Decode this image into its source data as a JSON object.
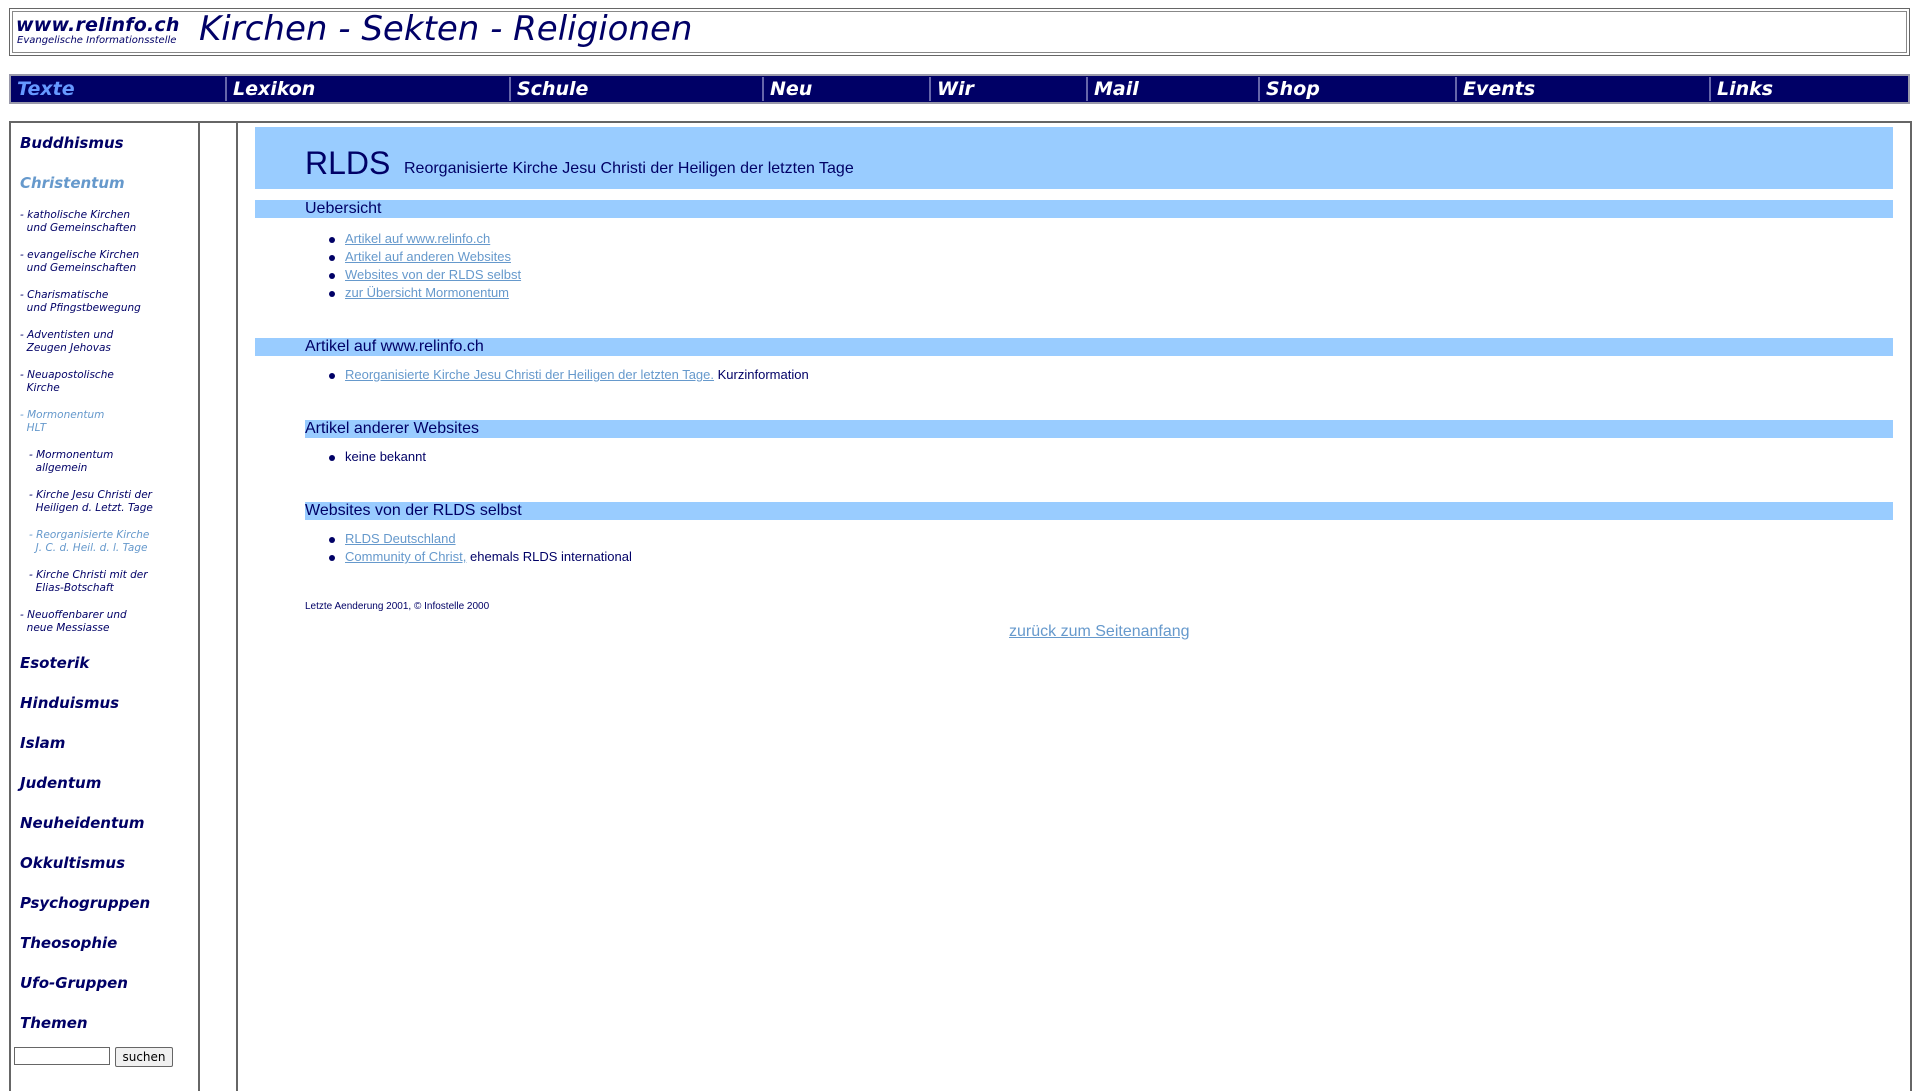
{
  "header": {
    "site_name": "www.relinfo.ch",
    "site_subtitle": "Evangelische Informationsstelle",
    "title": "Kirchen - Sekten - Religionen"
  },
  "nav": {
    "items": [
      "Texte",
      "Lexikon",
      "Schule",
      "Neu",
      "Wir",
      "Mail",
      "Shop",
      "Events",
      "Links"
    ],
    "active": "Texte"
  },
  "sidebar": {
    "top_items": [
      "Buddhismus",
      "Christentum"
    ],
    "sub_items": [
      "- katholische Kirchen\n  und Gemeinschaften",
      "- evangelische Kirchen\n  und Gemeinschaften",
      "- Charismatische\n  und Pfingstbewegung",
      "- Adventisten und\n  Zeugen Jehovas",
      "- Neuapostolische\n  Kirche",
      "- Mormonentum\n  HLT",
      "- Mormonentum\n  allgemein",
      "- Kirche Jesu Christi der\n  Heiligen d. Letzt. Tage",
      "- Reorganisierte Kirche\n  J. C. d. Heil. d. l. Tage",
      "- Kirche Christi mit der\n  Elias-Botschaft",
      "- Neuoffenbarer und\n  neue Messiasse"
    ],
    "bottom_items": [
      "Esoterik",
      "Hinduismus",
      "Islam",
      "Judentum",
      "Neuheidentum",
      "Okkultismus",
      "Psychogruppen",
      "Theosophie",
      "Ufo-Gruppen",
      "Themen"
    ],
    "search_value": "",
    "search_button": "suchen"
  },
  "main": {
    "title": "RLDS",
    "subtitle": "Reorganisierte Kirche Jesu Christi der Heiligen der letzten Tage",
    "overview": {
      "heading": "Uebersicht",
      "links": [
        "Artikel auf www.relinfo.ch",
        "Artikel auf anderen Websites",
        "Websites von der RLDS selbst",
        "zur Übersicht Mormonentum"
      ]
    },
    "relinfo": {
      "heading": "Artikel auf www.relinfo.ch",
      "link": "Reorganisierte Kirche Jesu Christi der Heiligen der letzten Tage.",
      "suffix": "Kurzinformation"
    },
    "other": {
      "heading": "Artikel anderer Websites",
      "item": "keine bekannt"
    },
    "own": {
      "heading": "Websites von der RLDS selbst",
      "link1": "RLDS Deutschland",
      "link2": "Community of Christ,",
      "link2_suffix": "ehemals RLDS international"
    },
    "footer_note": "Letzte Aenderung 2001, © Infostelle 2000",
    "back_to_top": "zurück zum Seitenanfang"
  },
  "colors": {
    "navy": "#000066",
    "band": "#99ccff",
    "link": "#6699cc",
    "active_nav": "#6699ff"
  }
}
